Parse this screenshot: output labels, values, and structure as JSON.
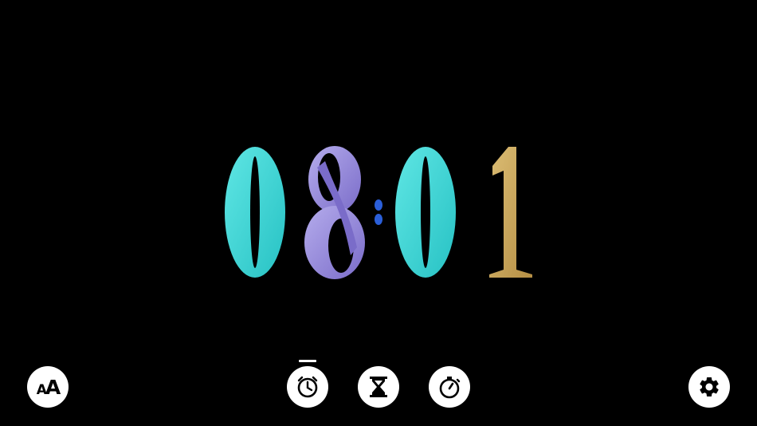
{
  "clock": {
    "digits": [
      "0",
      "8",
      "0",
      "1"
    ],
    "separator": ":",
    "colors": {
      "digit1": "#3fd6d6",
      "digit2": "#9b8fd6",
      "digit3": "#3fd6d6",
      "digit4": "#c9a55a",
      "separator": "#2b5fd9"
    }
  },
  "toolbar": {
    "font_button": {
      "label_small": "A",
      "label_big": "A",
      "icon": "font-size-icon"
    },
    "mode_buttons": [
      {
        "id": "clock",
        "icon": "clock-icon",
        "active": true
      },
      {
        "id": "timer",
        "icon": "hourglass-icon",
        "active": false
      },
      {
        "id": "stopwatch",
        "icon": "stopwatch-icon",
        "active": false
      }
    ],
    "settings_button": {
      "icon": "gear-icon"
    }
  }
}
